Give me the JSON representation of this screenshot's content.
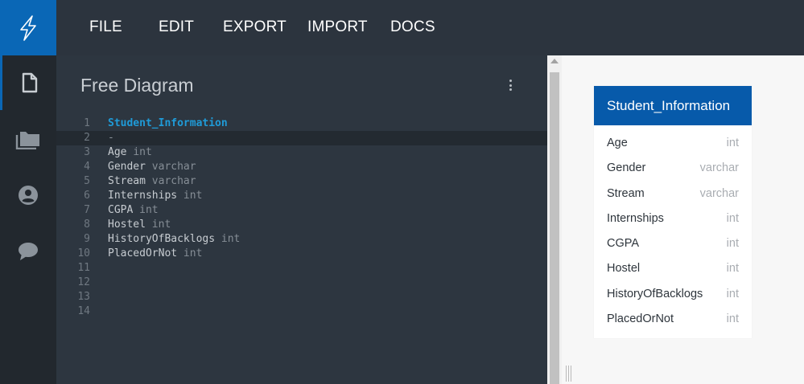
{
  "menu": [
    {
      "label": "FILE"
    },
    {
      "label": "EDIT"
    },
    {
      "label": "EXPORT"
    },
    {
      "label": "IMPORT"
    },
    {
      "label": "DOCS"
    }
  ],
  "nav_icons": [
    "document-icon",
    "folder-icon",
    "account-icon",
    "chat-icon"
  ],
  "editor": {
    "title": "Free Diagram",
    "lines": [
      {
        "num": "1",
        "name": "Student_Information",
        "type": ""
      },
      {
        "num": "2",
        "name": "-",
        "type": ""
      },
      {
        "num": "3",
        "name": "Age",
        "type": "int"
      },
      {
        "num": "4",
        "name": "Gender",
        "type": "varchar"
      },
      {
        "num": "5",
        "name": "Stream",
        "type": "varchar"
      },
      {
        "num": "6",
        "name": "Internships",
        "type": "int"
      },
      {
        "num": "7",
        "name": "CGPA",
        "type": "int"
      },
      {
        "num": "8",
        "name": "Hostel",
        "type": "int"
      },
      {
        "num": "9",
        "name": "HistoryOfBacklogs",
        "type": "int"
      },
      {
        "num": "10",
        "name": "PlacedOrNot",
        "type": "int"
      },
      {
        "num": "11",
        "name": "",
        "type": ""
      },
      {
        "num": "12",
        "name": "",
        "type": ""
      },
      {
        "num": "13",
        "name": "",
        "type": ""
      },
      {
        "num": "14",
        "name": "",
        "type": ""
      }
    ]
  },
  "diagram": {
    "table_name": "Student_Information",
    "fields": [
      {
        "name": "Age",
        "type": "int"
      },
      {
        "name": "Gender",
        "type": "varchar"
      },
      {
        "name": "Stream",
        "type": "varchar"
      },
      {
        "name": "Internships",
        "type": "int"
      },
      {
        "name": "CGPA",
        "type": "int"
      },
      {
        "name": "Hostel",
        "type": "int"
      },
      {
        "name": "HistoryOfBacklogs",
        "type": "int"
      },
      {
        "name": "PlacedOrNot",
        "type": "int"
      }
    ]
  },
  "colors": {
    "brand": "#0a67b6",
    "topbar": "#2c343e",
    "editor_bg": "#2d3640",
    "table_header": "#075aaa",
    "table_name_code": "#1f9bd8"
  }
}
